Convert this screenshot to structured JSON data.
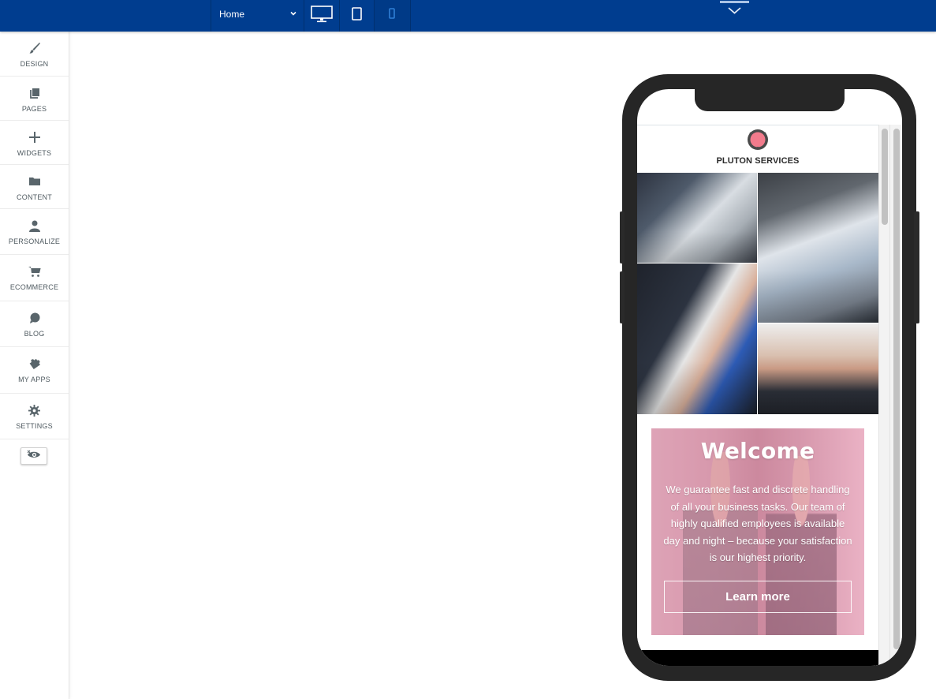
{
  "topbar": {
    "page_select": {
      "value": "Home"
    },
    "devices": [
      {
        "name": "desktop",
        "active": false
      },
      {
        "name": "tablet",
        "active": false
      },
      {
        "name": "mobile",
        "active": true
      }
    ],
    "colors": {
      "bar": "#003d8f",
      "active_device": "#2f7fd6"
    }
  },
  "sidebar": {
    "items": [
      {
        "label": "DESIGN",
        "icon": "paintbrush-icon"
      },
      {
        "label": "PAGES",
        "icon": "pages-icon"
      },
      {
        "label": "WIDGETS",
        "icon": "plus-icon"
      },
      {
        "label": "CONTENT",
        "icon": "folder-icon"
      },
      {
        "label": "PERSONALIZE",
        "icon": "user-icon"
      },
      {
        "label": "ECOMMERCE",
        "icon": "cart-icon"
      },
      {
        "label": "BLOG",
        "icon": "chat-bubble-icon"
      },
      {
        "label": "MY APPS",
        "icon": "puzzle-icon"
      },
      {
        "label": "SETTINGS",
        "icon": "gear-icon"
      }
    ],
    "preview_toggle": {
      "icon": "eye-hidden-icon"
    }
  },
  "site": {
    "brand": "PLUTON SERVICES",
    "gallery": [
      {
        "alt": "team-meeting-laptop-photo"
      },
      {
        "alt": "typing-on-laptop-photo"
      },
      {
        "alt": "handshake-photo"
      },
      {
        "alt": "smiling-team-photo"
      }
    ],
    "hero": {
      "title": "Welcome",
      "body": "We guarantee fast and discrete handling of all your business tasks. Our team of highly qualified employees is available day and night – because your satisfaction is our highest priority.",
      "cta": "Learn more"
    },
    "colors": {
      "hero_tint": "#e7a9bf",
      "logo_accent": "#f27b8c"
    }
  }
}
